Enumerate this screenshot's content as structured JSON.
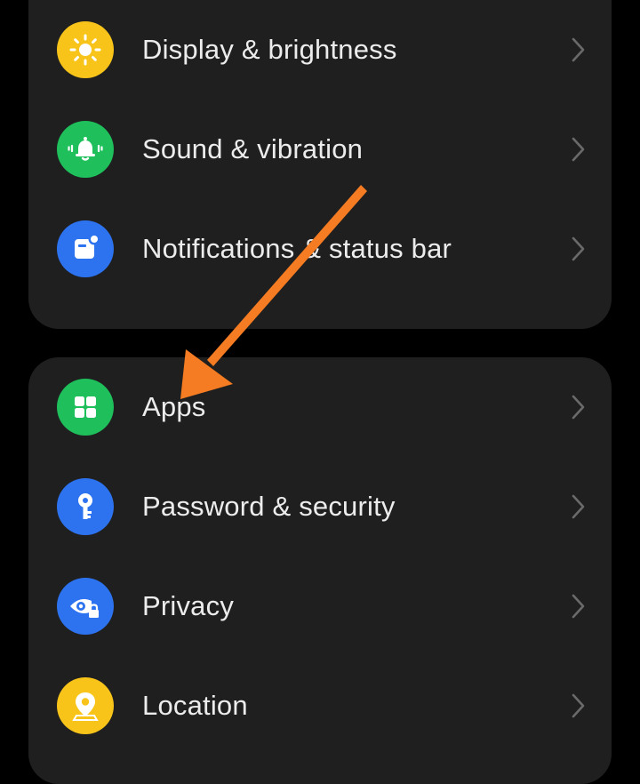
{
  "colors": {
    "background": "#000000",
    "card": "#1f1f1f",
    "label": "#ececec",
    "chevron": "#6a6a6a",
    "annotation_arrow": "#f57c22"
  },
  "group_display": {
    "items": [
      {
        "label": "Display & brightness",
        "icon": "sun-icon",
        "icon_bg": "#f8c41a"
      },
      {
        "label": "Sound & vibration",
        "icon": "bell-icon",
        "icon_bg": "#1fbf5c"
      },
      {
        "label": "Notifications & status bar",
        "icon": "notification-icon",
        "icon_bg": "#2d73f0"
      }
    ]
  },
  "group_apps": {
    "items": [
      {
        "label": "Apps",
        "icon": "apps-grid-icon",
        "icon_bg": "#1fbf5c"
      },
      {
        "label": "Password & security",
        "icon": "key-icon",
        "icon_bg": "#2d73f0"
      },
      {
        "label": "Privacy",
        "icon": "privacy-eye-lock-icon",
        "icon_bg": "#2d73f0"
      },
      {
        "label": "Location",
        "icon": "location-pin-icon",
        "icon_bg": "#f8c41a"
      }
    ]
  },
  "annotation": {
    "type": "arrow",
    "points_to": "Apps"
  }
}
